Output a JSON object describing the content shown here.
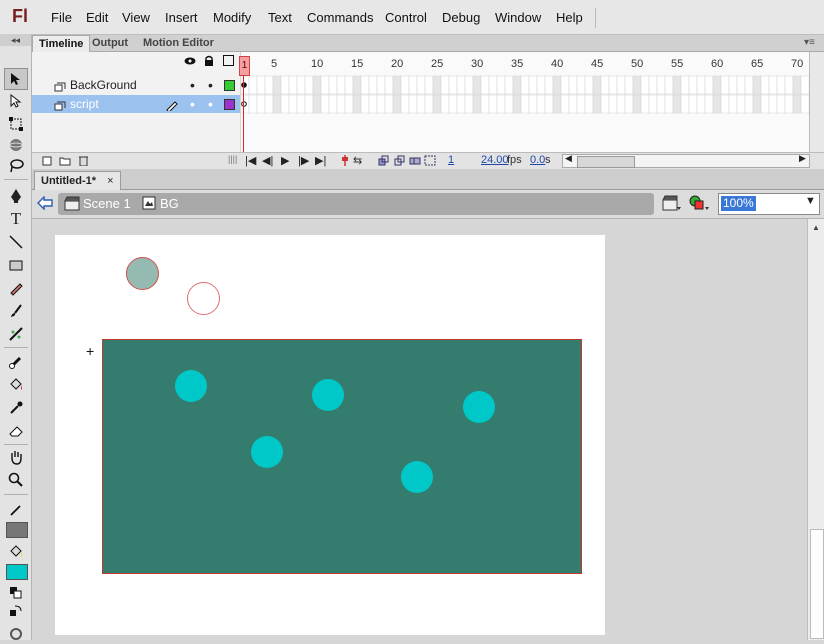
{
  "app": {
    "logo": "Fl"
  },
  "menu": [
    "File",
    "Edit",
    "View",
    "Insert",
    "Modify",
    "Text",
    "Commands",
    "Control",
    "Debug",
    "Window",
    "Help"
  ],
  "panel_tabs": [
    "Timeline",
    "Output",
    "Motion Editor"
  ],
  "layers": [
    {
      "name": "BackGround",
      "color": "#33cc33"
    },
    {
      "name": "script",
      "color": "#9933cc"
    }
  ],
  "frame_numbers": [
    "1",
    "5",
    "10",
    "15",
    "20",
    "25",
    "30",
    "35",
    "40",
    "45",
    "50",
    "55",
    "60",
    "65",
    "70"
  ],
  "timeline": {
    "frame": "1",
    "fps": "24.00",
    "fps_unit": "fps",
    "time": "0.0",
    "time_unit": "s"
  },
  "document": {
    "tab": "Untitled-1*",
    "close": "×"
  },
  "editbar": {
    "scene": "Scene 1",
    "symbol": "BG",
    "zoom": "100%"
  },
  "colors": {
    "stage_bg": "#337c6e",
    "dot": "#00c8c8",
    "stroke_swatch": "#777777",
    "fill_swatch": "#00c8c8"
  }
}
